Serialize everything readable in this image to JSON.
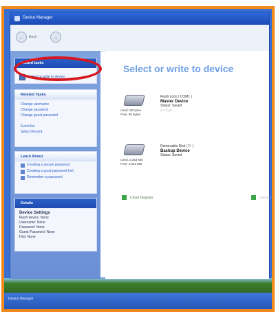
{
  "window": {
    "title": "Device Manager"
  },
  "toolbar": {
    "back_label": "Back"
  },
  "sidebar": {
    "tasks_header": "Wizard tasks",
    "selected_task": "Select or write to device",
    "related_header": "Related Tasks",
    "related_links": [
      "Change username",
      "Change password",
      "Change guest password"
    ],
    "other_links": [
      "Event list",
      "Select Record"
    ],
    "learn_header": "Learn About",
    "learn_links": [
      "Creating a secure password",
      "Creating a good password hint",
      "Remember a password"
    ],
    "details_header": "Details",
    "details": {
      "title": "Device Settings",
      "lines": [
        "Flash device: None",
        "Username: None",
        "Password: None",
        "Guest Password: None",
        "Hint: None"
      ]
    }
  },
  "main": {
    "title": "Select or write to device",
    "devices": [
      {
        "used": "Used: 28 bytes",
        "free": "Free: 99 bytes",
        "label": "Flash Lock ( COM1 )",
        "name": "Master Device",
        "status": "Status: Saved",
        "extra": "Encrypt ..."
      },
      {
        "used": "Used: 2,363 MB",
        "free": "Free: 2,540 MB",
        "label": "Removable Disk ( F: )",
        "name": "Backup Device",
        "status": "Status: Saved"
      }
    ],
    "bottom_links": [
      "Cloud Diagram",
      "Upload"
    ]
  },
  "taskbar": {
    "item": "Device Manager"
  },
  "colors": {
    "frame": "#f08a1e",
    "highlight": "#d7171f",
    "title": "#6ea0e6",
    "sidebar": "#6b90d6"
  }
}
